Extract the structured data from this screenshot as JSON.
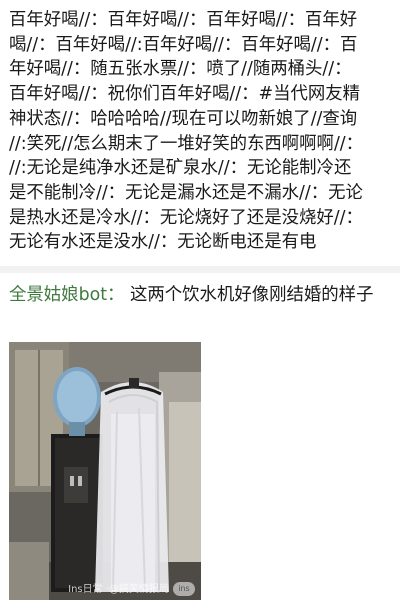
{
  "post": {
    "lines": [
      "百年好喝//：百年好喝//：百年好喝//：百年好",
      "喝//：百年好喝//:百年好喝//：百年好喝//：百",
      "年好喝//：随五张水票//：喷了//随两桶头//：",
      "百年好喝//：祝你们百年好喝//：#当代网友精",
      "神状态//：哈哈哈哈//现在可以吻新娘了//查询",
      "//:笑死//怎么期末了一堆好笑的东西啊啊啊//：",
      "//:无论是纯净水还是矿泉水//：无论能制冷还",
      "是不能制冷//：无论是漏水还是不漏水//：无论",
      "是热水还是冷水//：无论烧好了还是没烧好//：",
      "无论有水还是没水//：无论断电还是有电"
    ]
  },
  "comment": {
    "author": "全景姑娘bot：",
    "text": "这两个饮水机好像刚结婚的样子"
  },
  "photo": {
    "watermark": "Ins日常  ·@搞笑情报局",
    "watermark_logo": "ins"
  }
}
